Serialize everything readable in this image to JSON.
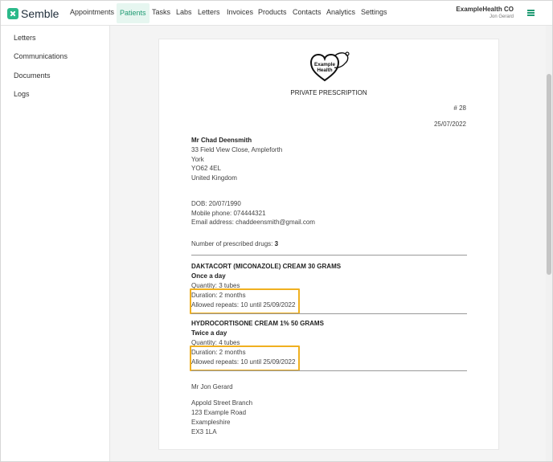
{
  "app": {
    "logo_text": "Semble",
    "org_name": "ExampleHealth CO",
    "user_name": "Jon Gerard"
  },
  "nav": {
    "items": [
      "Appointments",
      "Patients",
      "Tasks",
      "Labs",
      "Letters",
      "Invoices",
      "Products",
      "Contacts",
      "Analytics",
      "Settings"
    ],
    "active": "Patients"
  },
  "sidebar": {
    "items": [
      "Letters",
      "Communications",
      "Documents",
      "Logs"
    ]
  },
  "document": {
    "logo_text_1": "Example",
    "logo_text_2": "Health",
    "title": "PRIVATE PRESCRIPTION",
    "number": "# 28",
    "date": "25/07/2022",
    "patient": {
      "name": "Mr Chad Deensmith",
      "address": [
        "33 Field View Close, Ampleforth",
        "York",
        "YO62 4EL",
        "United Kingdom"
      ],
      "dob": "DOB: 20/07/1990",
      "mobile": "Mobile phone: 074444321",
      "email": "Email address: chaddeensmith@gmail.com"
    },
    "drug_count_label": "Number of prescribed drugs:",
    "drug_count": "3",
    "drugs": [
      {
        "name": "DAKTACORT (MICONAZOLE) CREAM 30 GRAMS",
        "frequency": "Once a day",
        "quantity": "Quantity: 3 tubes",
        "duration": "Duration: 2 months",
        "repeats": "Allowed repeats: 10 until 25/09/2022"
      },
      {
        "name": "HYDROCORTISONE CREAM 1% 50 GRAMS",
        "frequency": "Twice a day",
        "quantity": "Quantity: 4 tubes",
        "duration": "Duration: 2 months",
        "repeats": "Allowed repeats: 10 until 25/09/2022"
      }
    ],
    "prescriber": {
      "name": "Mr Jon Gerard",
      "address": [
        "Appold Street Branch",
        "123 Example Road",
        "Exampleshire",
        "EX3 1LA"
      ]
    }
  },
  "colors": {
    "brand": "#2bb98a",
    "active_nav_bg": "#e6f6f0",
    "highlight": "#f0b020"
  }
}
